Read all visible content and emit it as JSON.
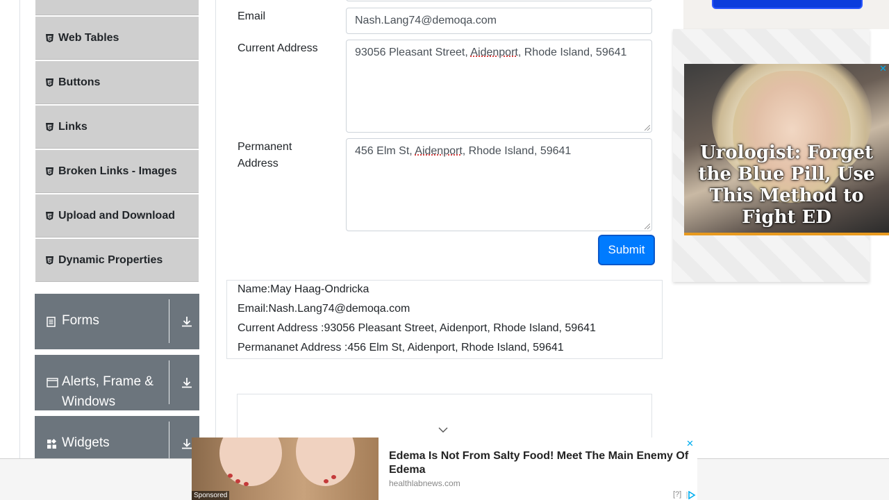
{
  "sidebar": {
    "items": [
      {
        "label": "Web Tables",
        "icon": "html5-icon"
      },
      {
        "label": "Buttons",
        "icon": "html5-icon"
      },
      {
        "label": "Links",
        "icon": "html5-icon"
      },
      {
        "label": "Broken Links - Images",
        "icon": "html5-icon"
      },
      {
        "label": "Upload and Download",
        "icon": "html5-icon"
      },
      {
        "label": "Dynamic Properties",
        "icon": "html5-icon"
      }
    ],
    "groups": [
      {
        "label": "Forms",
        "icon": "document-list-icon"
      },
      {
        "label_line1": "Alerts, Frame &",
        "label_line2": "Windows",
        "icon": "window-icon"
      },
      {
        "label": "Widgets",
        "icon": "widgets-icon"
      }
    ]
  },
  "form": {
    "email_label": "Email",
    "email_value": "Nash.Lang74@demoqa.com",
    "current_address_label": "Current Address",
    "current_address_parts": [
      "93056 Pleasant Street, ",
      "Aidenport",
      ", Rhode Island, 59641"
    ],
    "permanent_address_label_line1": "Permanent",
    "permanent_address_label_line2": "Address",
    "permanent_address_parts": [
      "456 Elm St, ",
      "Aidenport",
      ", Rhode Island, 59641"
    ],
    "submit_label": "Submit"
  },
  "output": {
    "name": "Name:May Haag-Ondricka",
    "email": "Email:Nash.Lang74@demoqa.com",
    "current_address": "Current Address :93056 Pleasant Street, Aidenport, Rhode Island, 59641",
    "permanent_address": "Permananet Address :456 Elm St, Aidenport, Rhode Island, 59641"
  },
  "right_ad": {
    "headline": "Urologist: Forget the Blue Pill, Use This Method to Fight ED",
    "close": "✕"
  },
  "bottom_ad": {
    "title": "Edema Is Not From Salty Food! Meet The Main Enemy Of Edema",
    "source": "healthlabnews.com",
    "sponsored": "Sponsored",
    "help": "[?]",
    "close": "✕"
  },
  "colors": {
    "accent": "#007bff",
    "group_bg": "#6c757d",
    "menu_bg": "#cfcfcf"
  }
}
